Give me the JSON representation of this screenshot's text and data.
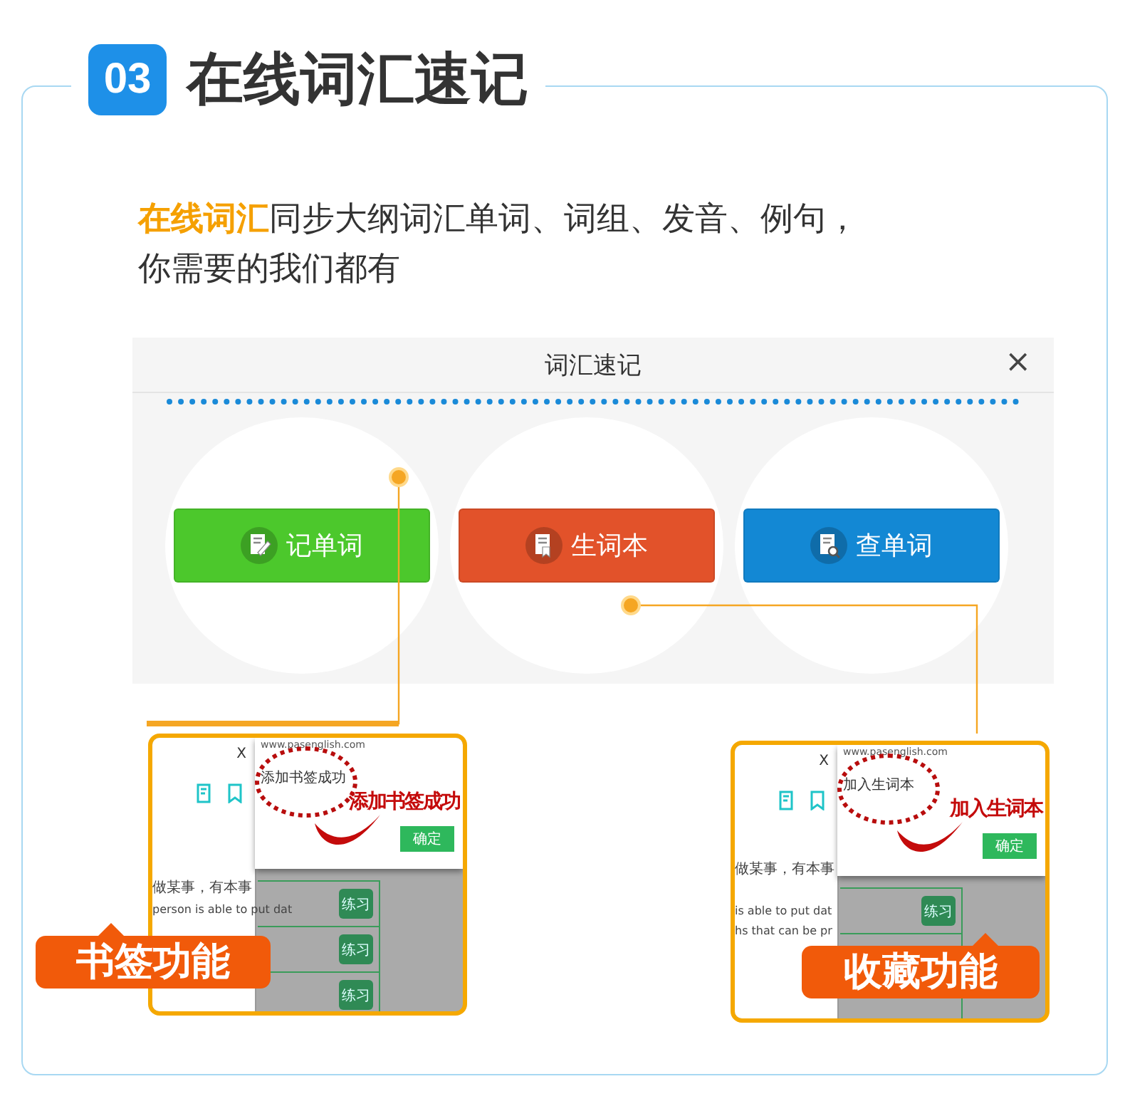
{
  "header": {
    "number": "03",
    "title": "在线词汇速记"
  },
  "intro": [
    "**在线词汇**同步大纲词汇单词、词组、发音、例句，",
    "你需要的我们都有"
  ],
  "window": {
    "title": "词汇速记",
    "close": "×",
    "buttons": [
      {
        "label": "记单词",
        "color": "#4cc82c",
        "kind": "write"
      },
      {
        "label": "生词本",
        "color": "#e2522a",
        "kind": "book"
      },
      {
        "label": "查单词",
        "color": "#1388d4",
        "kind": "search"
      }
    ]
  },
  "insets": [
    {
      "close": "X",
      "url": "www.pasenglish.com",
      "small_message": "添加书签成功",
      "big_message": "添加书签成功",
      "ok": "确定",
      "side_lines": [
        "做某事，有本事",
        "person is able to put dat"
      ],
      "practice": [
        "练习",
        "练习",
        "练习"
      ],
      "callout": "书签功能"
    },
    {
      "close": "X",
      "url": "www.pasenglish.com",
      "small_message": "加入生词本",
      "big_message": "加入生词本",
      "ok": "确定",
      "side_lines": [
        "做某事，有本事",
        "is able to put dat",
        "hs that can be pr"
      ],
      "practice": [
        "练习"
      ],
      "callout": "收藏功能"
    }
  ]
}
